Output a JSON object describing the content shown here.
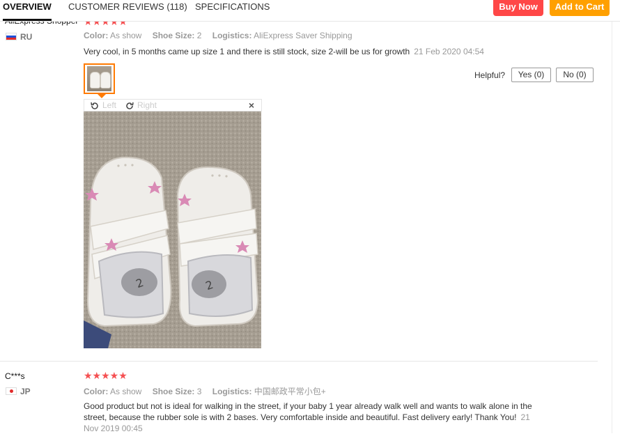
{
  "tabs": {
    "overview": "OVERVIEW",
    "reviews": "CUSTOMER REVIEWS (118)",
    "specs": "SPECIFICATIONS"
  },
  "actions": {
    "buy_now": "Buy Now",
    "add_to_cart": "Add to Cart"
  },
  "colors": {
    "buy_now": "#ff4747",
    "add_to_cart": "#ffa000",
    "stars": "#f55052",
    "thumb_border": "#ff7a00"
  },
  "reviews": [
    {
      "buyer": "AliExpress Shopper",
      "country": "RU",
      "flag": "russia-flag-icon",
      "rating": 5,
      "stars": "★★★★★",
      "attributes": {
        "color_key": "Color:",
        "color_val": "As show",
        "size_key": "Shoe Size:",
        "size_val": "2",
        "logistics_key": "Logistics:",
        "logistics_val": "AliExpress Saver Shipping"
      },
      "text": "Very cool, in 5 months came up size 1 and there is still stock, size 2-will be us for growth",
      "date": "21 Feb 2020 04:54",
      "helpful": {
        "label": "Helpful?",
        "yes": "Yes (0)",
        "no": "No (0)"
      },
      "viewer": {
        "rotate_left": "Left",
        "rotate_right": "Right",
        "close": "×"
      }
    },
    {
      "buyer": "C***s",
      "country": "JP",
      "flag": "japan-flag-icon",
      "rating": 5,
      "stars": "★★★★★",
      "attributes": {
        "color_key": "Color:",
        "color_val": "As show",
        "size_key": "Shoe Size:",
        "size_val": "3",
        "logistics_key": "Logistics:",
        "logistics_val": "中国邮政平常小包+"
      },
      "text": "Good product but not is ideal for walking in the street, if your baby 1 year already walk well and wants to walk alone in the street, because the rubber sole is with 2 bases. Very comfortable inside and beautiful. Fast delivery early! Thank You!",
      "date": "21 Nov 2019 00:45"
    }
  ]
}
